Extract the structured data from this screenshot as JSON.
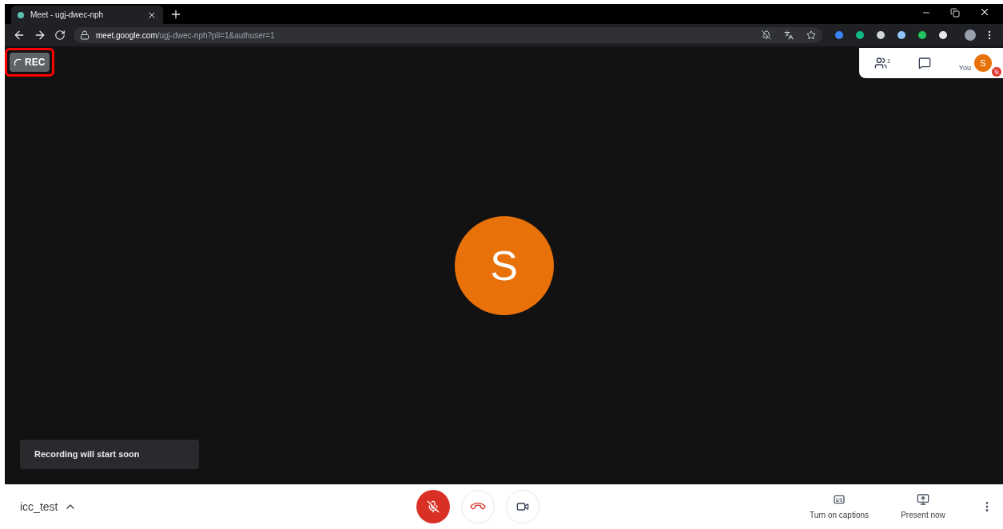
{
  "browser": {
    "tab_title": "Meet - ugj-dwec-nph",
    "url_host": "meet.google.com",
    "url_path": "/ugj-dwec-nph?pli=1&authuser=1"
  },
  "recording": {
    "label": "REC",
    "highlighted": true,
    "toast": "Recording will start soon"
  },
  "top_panel": {
    "participants_count": "1",
    "self_label": "You",
    "self_initial": "S",
    "self_muted": true
  },
  "main_avatar": {
    "initial": "S"
  },
  "bottom_bar": {
    "meeting_name": "icc_test",
    "mic_muted": true,
    "captions_label": "Turn on captions",
    "present_label": "Present now"
  }
}
